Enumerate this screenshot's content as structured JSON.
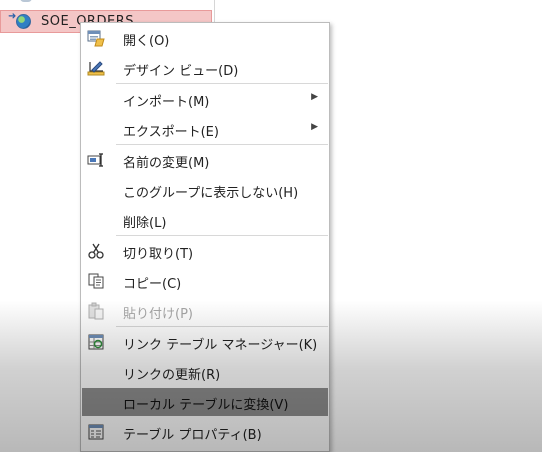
{
  "nav_pane": {
    "selected_item": {
      "label": "SOE_ORDERS"
    }
  },
  "context_menu": {
    "items": [
      {
        "label": "開く(O)",
        "icon": "open-form-icon"
      },
      {
        "label": "デザイン ビュー(D)",
        "icon": "design-view-icon"
      },
      {
        "label": "インポート(M)",
        "icon": "",
        "submenu": true
      },
      {
        "label": "エクスポート(E)",
        "icon": "",
        "submenu": true
      },
      {
        "label": "名前の変更(M)",
        "icon": "rename-icon"
      },
      {
        "label": "このグループに表示しない(H)",
        "icon": ""
      },
      {
        "label": "削除(L)",
        "icon": ""
      },
      {
        "label": "切り取り(T)",
        "icon": "scissors-icon"
      },
      {
        "label": "コピー(C)",
        "icon": "copy-icon"
      },
      {
        "label": "貼り付け(P)",
        "icon": "paste-icon",
        "disabled": true
      },
      {
        "label": "リンク テーブル マネージャー(K)",
        "icon": "linked-table-manager-icon"
      },
      {
        "label": "リンクの更新(R)",
        "icon": ""
      },
      {
        "label": "ローカル テーブルに変換(V)",
        "icon": "",
        "highlighted": true
      },
      {
        "label": "テーブル プロパティ(B)",
        "icon": "table-properties-icon"
      }
    ],
    "submenu_arrow": "▶"
  },
  "colors": {
    "selection_fill": "#f4c6c6",
    "selection_border": "#e89a9a",
    "menu_highlight": "#8e8e8e"
  }
}
